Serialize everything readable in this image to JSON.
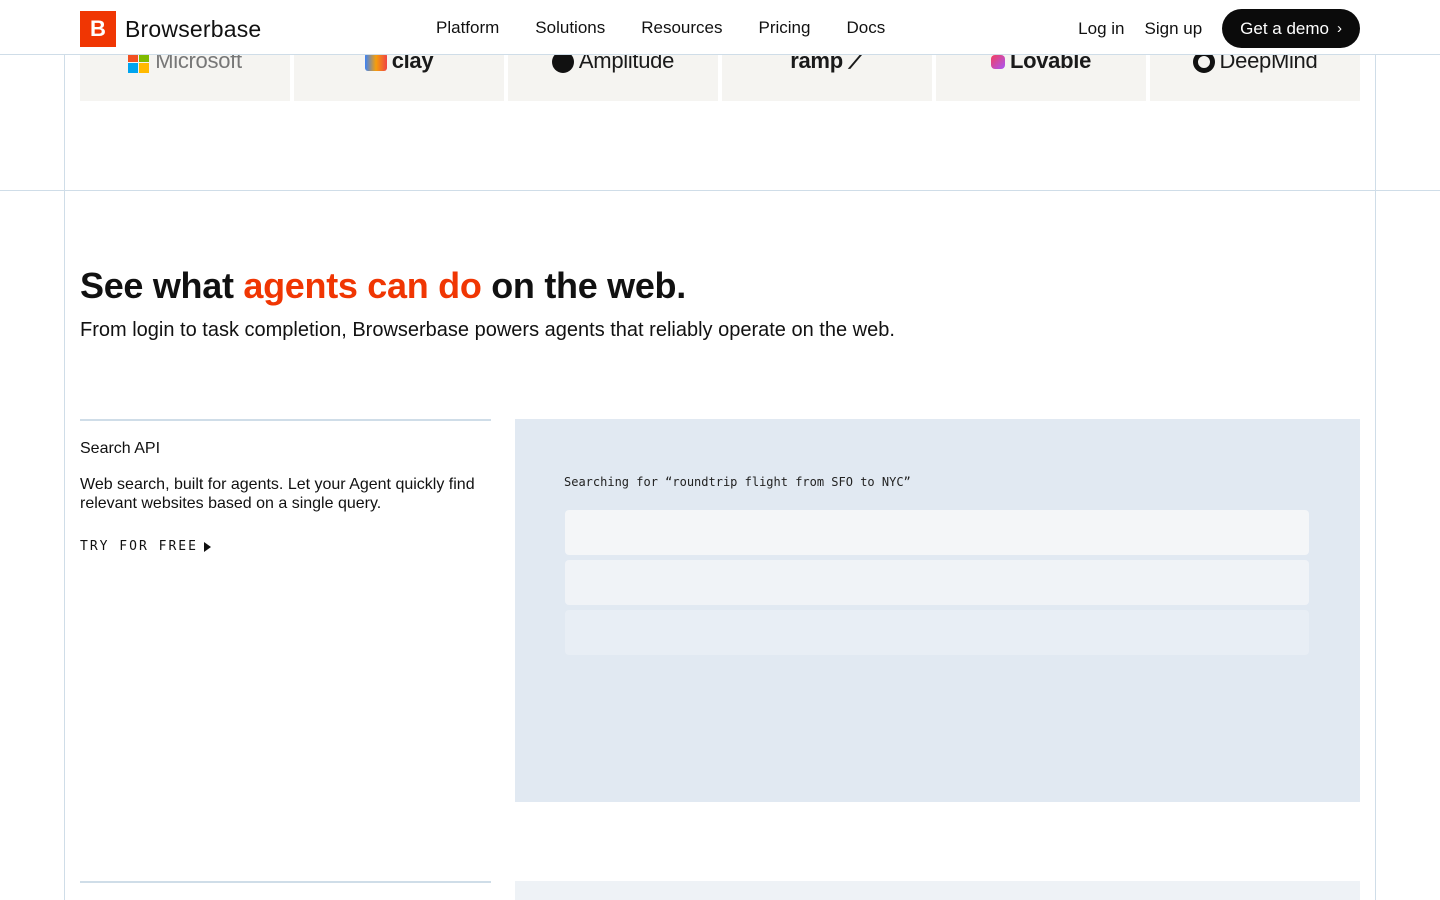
{
  "header": {
    "brand_mark": "B",
    "brand_name": "Browserbase",
    "nav": [
      "Platform",
      "Solutions",
      "Resources",
      "Pricing",
      "Docs"
    ],
    "login": "Log in",
    "signup": "Sign up",
    "demo": "Get a demo",
    "demo_icon": "chevron-right-icon"
  },
  "logos": [
    {
      "name": "Microsoft",
      "text": "Microsoft"
    },
    {
      "name": "Clay",
      "text": "clay"
    },
    {
      "name": "Amplitude",
      "text": "Amplitude"
    },
    {
      "name": "Ramp",
      "text": "ramp ⟋"
    },
    {
      "name": "Lovable",
      "text": "Lovable"
    },
    {
      "name": "DeepMind",
      "text": "DeepMind"
    }
  ],
  "hero": {
    "title_start": "See what ",
    "title_accent": "agents can do",
    "title_end": " on the web.",
    "subtitle": "From login to task completion, Browserbase powers agents that reliably operate on the web.",
    "accent_color": "#f03603"
  },
  "feature": {
    "title": "Search API",
    "description": "Web search, built for agents. Let your Agent quickly find relevant websites based on a single query.",
    "cta": "TRY FOR FREE",
    "cta_icon": "play-icon"
  },
  "panel": {
    "query": "Searching for “roundtrip flight from SFO to NYC”"
  }
}
